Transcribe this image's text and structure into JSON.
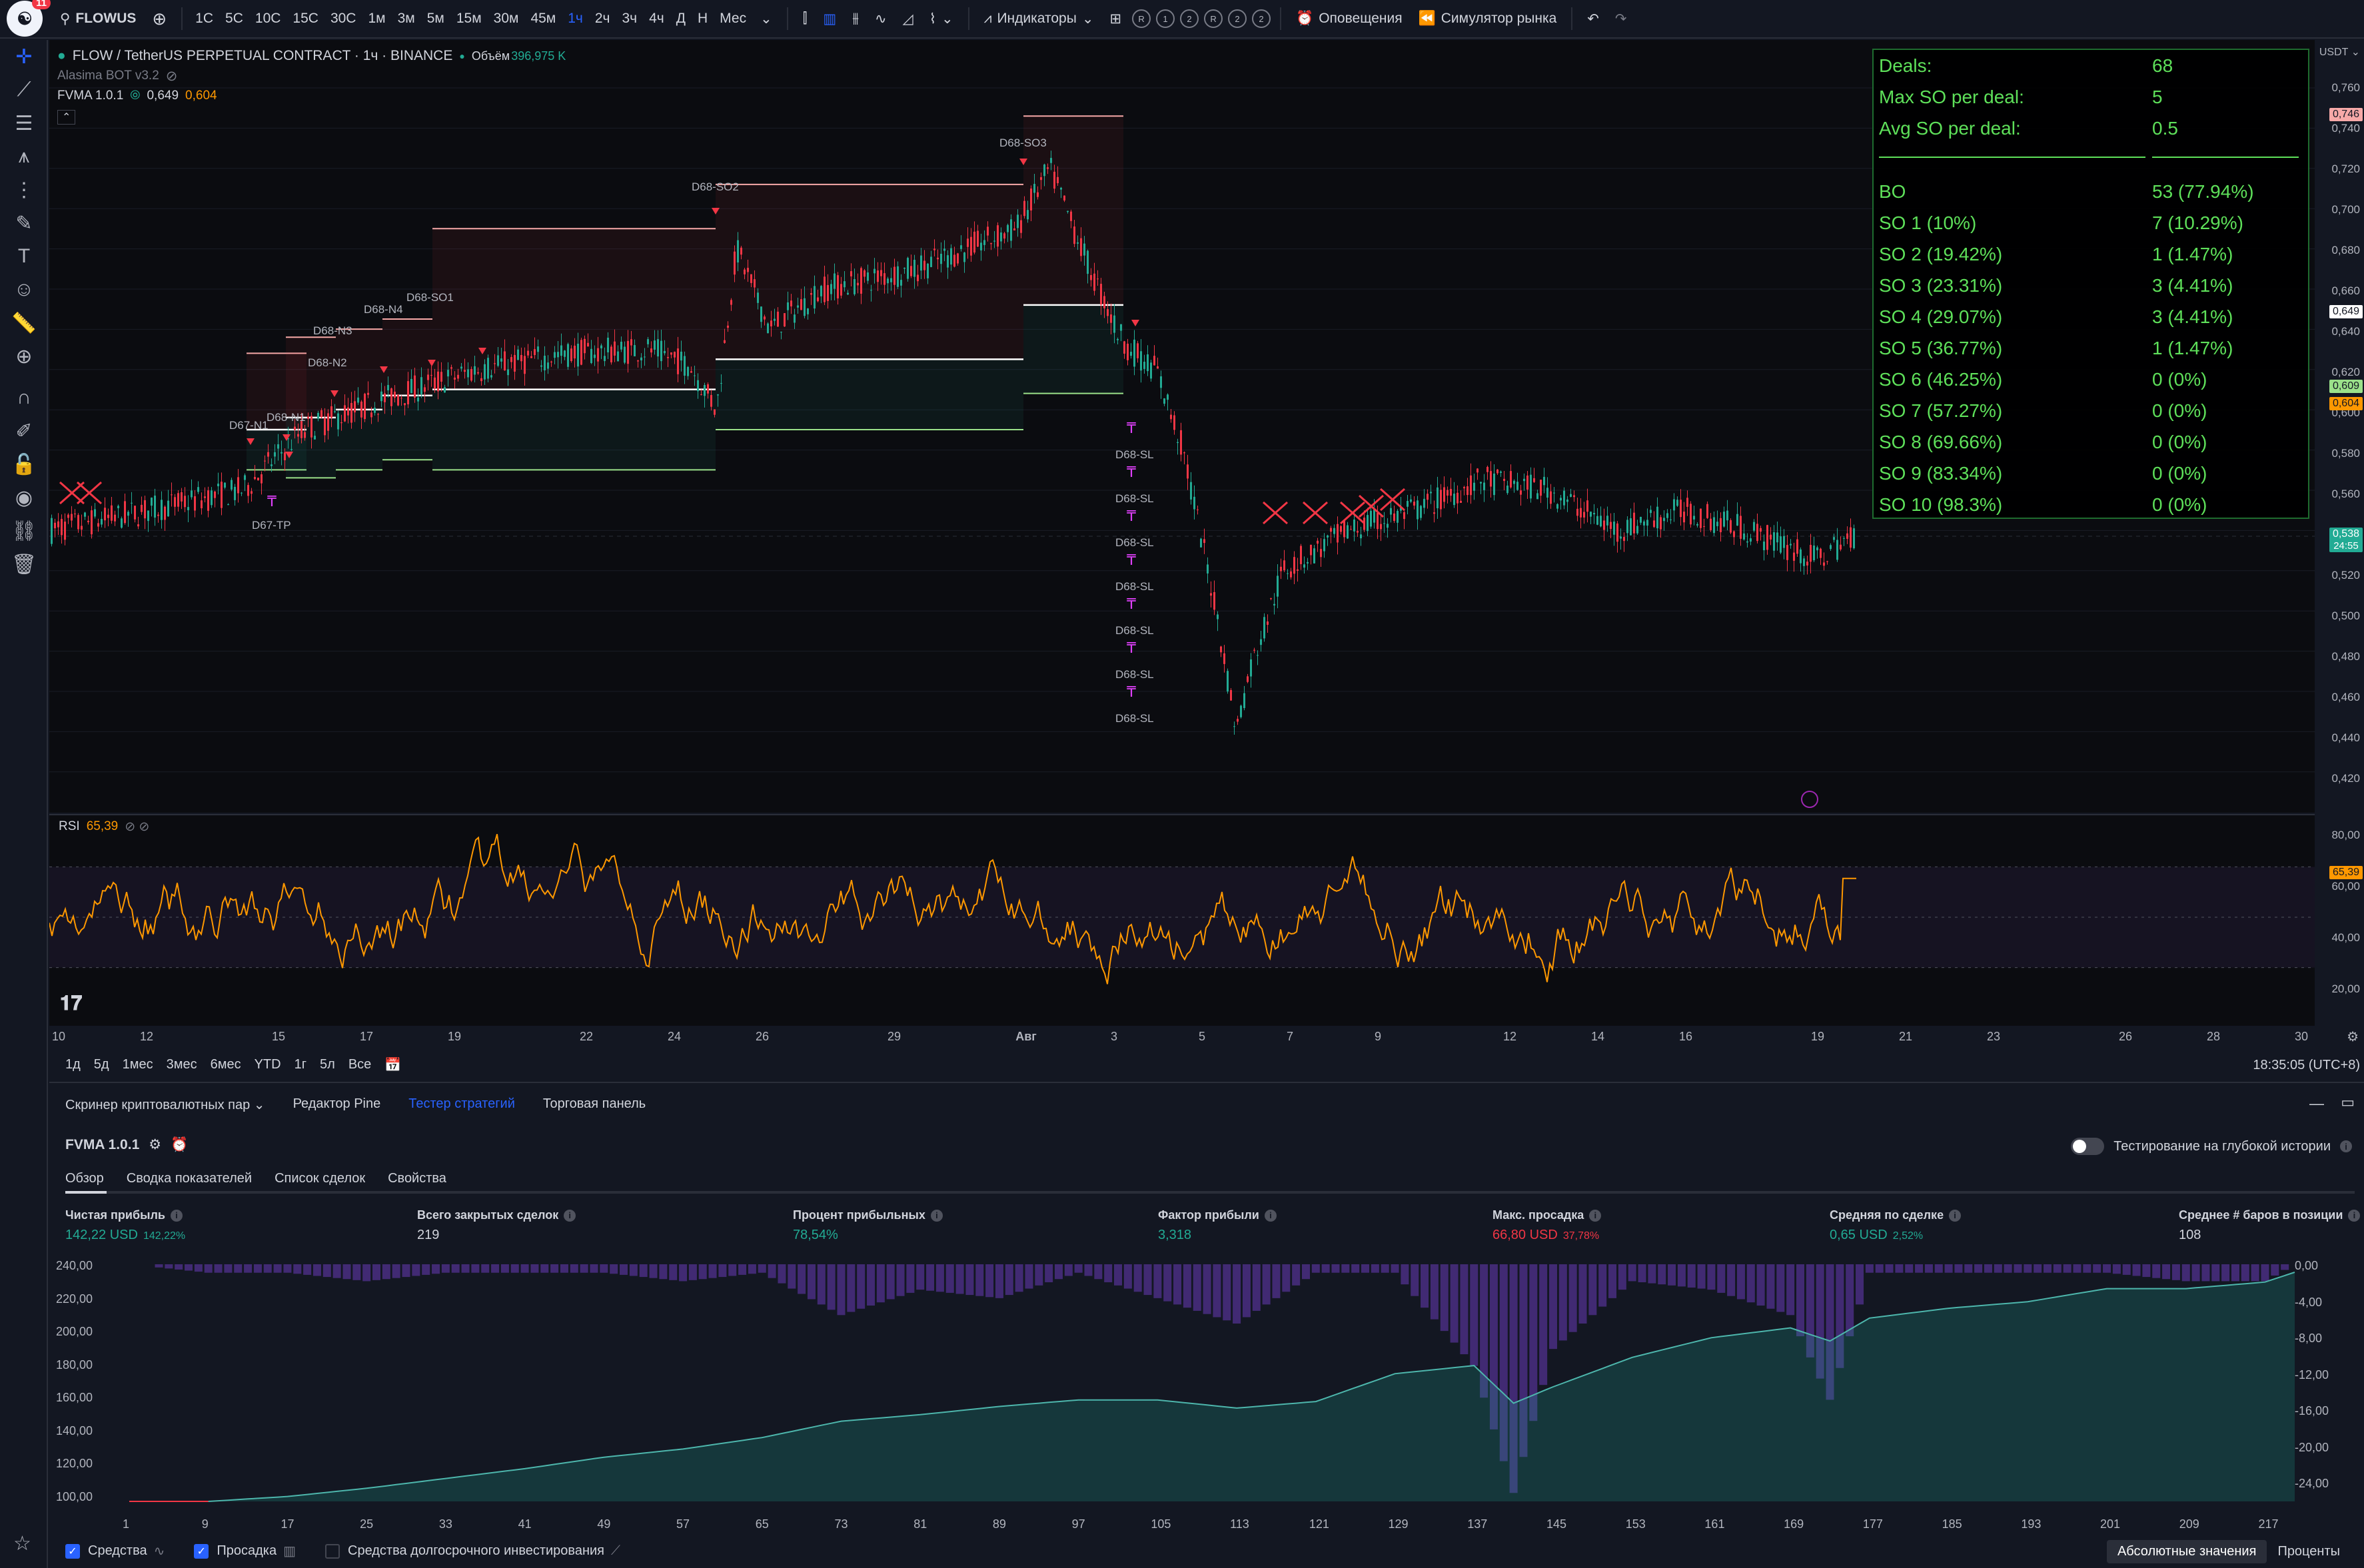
{
  "topbar": {
    "badge": "11",
    "symbol": "FLOWUS",
    "intervals": [
      "1С",
      "5С",
      "10С",
      "15С",
      "30С",
      "1м",
      "3м",
      "5м",
      "15м",
      "30м",
      "45м",
      "1ч",
      "2ч",
      "3ч",
      "4ч",
      "Д",
      "Н",
      "Мес"
    ],
    "active_interval": "1ч",
    "indicators_label": "Индикаторы",
    "circle_buttons": [
      "R",
      "1",
      "2",
      "R",
      "2",
      "2"
    ],
    "alerts_label": "Оповещения",
    "replay_label": "Симулятор рынка"
  },
  "legend": {
    "title": "FLOW / TetherUS PERPETUAL CONTRACT · 1ч · BINANCE",
    "volume_label": "Объём",
    "volume_value": "396,975 K",
    "bot_label": "Alasima BOT v3.2",
    "fvma_label": "FVMA 1.0.1",
    "fvma_v1": "0,649",
    "fvma_v2": "0,604"
  },
  "stats": [
    {
      "k": "Deals:",
      "v": "68"
    },
    {
      "k": "Max SO per deal:",
      "v": "5"
    },
    {
      "k": "Avg SO per deal:",
      "v": "0.5"
    },
    {
      "k": "BO",
      "v": "53 (77.94%)"
    },
    {
      "k": "SO 1 (10%)",
      "v": "7 (10.29%)"
    },
    {
      "k": "SO 2 (19.42%)",
      "v": "1 (1.47%)"
    },
    {
      "k": "SO 3 (23.31%)",
      "v": "3 (4.41%)"
    },
    {
      "k": "SO 4 (29.07%)",
      "v": "3 (4.41%)"
    },
    {
      "k": "SO 5 (36.77%)",
      "v": "1 (1.47%)"
    },
    {
      "k": "SO 6 (46.25%)",
      "v": "0 (0%)"
    },
    {
      "k": "SO 7 (57.27%)",
      "v": "0 (0%)"
    },
    {
      "k": "SO 8 (69.66%)",
      "v": "0 (0%)"
    },
    {
      "k": "SO 9 (83.34%)",
      "v": "0 (0%)"
    },
    {
      "k": "SO 10 (98.3%)",
      "v": "0 (0%)"
    }
  ],
  "price_axis": {
    "currency": "USDT",
    "ticks": [
      "0,760",
      "0,740",
      "0,720",
      "0,700",
      "0,680",
      "0,660",
      "0,640",
      "0,620",
      "0,600",
      "0,580",
      "0,560",
      "0,540",
      "0,520",
      "0,500",
      "0,480",
      "0,460",
      "0,440",
      "0,420"
    ],
    "tag_high": "0,746",
    "tag_fvma": "0,649",
    "tag_green": "0,609",
    "tag_orange": "0,604",
    "tag_last": "0,538",
    "tag_countdown": "24:55"
  },
  "chart_labels": {
    "d67_n1": "D67-N1",
    "d67_tp": "D67-TP",
    "d68_n1": "D68-N1",
    "d68_n2": "D68-N2",
    "d68_n3": "D68-N3",
    "d68_n4": "D68-N4",
    "d68_so1": "D68-SO1",
    "d68_so2": "D68-SO2",
    "d68_so3": "D68-SO3",
    "d68_sl": "D68-SL"
  },
  "rsi": {
    "label": "RSI",
    "value": "65,39",
    "ticks": [
      "80,00",
      "60,00",
      "40,00",
      "20,00"
    ]
  },
  "time_axis": [
    "10",
    "12",
    "15",
    "17",
    "19",
    "22",
    "24",
    "26",
    "29",
    "Авг",
    "3",
    "5",
    "7",
    "9",
    "12",
    "14",
    "16",
    "19",
    "21",
    "23",
    "26",
    "28",
    "30"
  ],
  "range_bar": {
    "items": [
      "1д",
      "5д",
      "1мес",
      "3мес",
      "6мес",
      "YTD",
      "1г",
      "5л",
      "Все"
    ],
    "clock": "18:35:05 (UTC+8)"
  },
  "bottom": {
    "tabs": [
      "Скринер криптовалютных пар",
      "Редактор Pine",
      "Тестер стратегий",
      "Торговая панель"
    ],
    "active_tab": "Тестер стратегий",
    "strategy": "FVMA 1.0.1",
    "deep_history": "Тестирование на глубокой истории",
    "sub_tabs": [
      "Обзор",
      "Сводка показателей",
      "Список сделок",
      "Свойства"
    ],
    "metrics": [
      {
        "k": "Чистая прибыль",
        "v": "142,22 USD",
        "p": "142,22%",
        "c": "green"
      },
      {
        "k": "Всего закрытых сделок",
        "v": "219",
        "p": "",
        "c": "white"
      },
      {
        "k": "Процент прибыльных",
        "v": "78,54%",
        "p": "",
        "c": "green"
      },
      {
        "k": "Фактор прибыли",
        "v": "3,318",
        "p": "",
        "c": "green"
      },
      {
        "k": "Макс. просадка",
        "v": "66,80 USD",
        "p": "37,78%",
        "c": "red"
      },
      {
        "k": "Средняя по сделке",
        "v": "0,65 USD",
        "p": "2,52%",
        "c": "green"
      },
      {
        "k": "Среднее # баров в позиции",
        "v": "108",
        "p": "",
        "c": "white"
      }
    ],
    "legend": [
      "Средства",
      "Просадка",
      "Средства долгосрочного инвестирования"
    ],
    "view_modes": [
      "Абсолютные значения",
      "Проценты"
    ]
  },
  "chart_data": [
    {
      "type": "line",
      "name_on_chart": "RSI",
      "y_ticks": [
        80,
        60,
        40,
        20
      ],
      "last_value": 65.39
    },
    {
      "type": "area",
      "x_ticks": [
        1,
        9,
        17,
        25,
        33,
        41,
        49,
        57,
        65,
        73,
        81,
        89,
        97,
        105,
        113,
        121,
        129,
        137,
        145,
        153,
        161,
        169,
        177,
        185,
        193,
        201,
        209,
        217
      ],
      "left_axis_ticks": [
        "240,00",
        "220,00",
        "200,00",
        "180,00",
        "160,00",
        "140,00",
        "120,00",
        "100,00"
      ],
      "right_axis_ticks": [
        "0,00",
        "-4,00",
        "-8,00",
        "-12,00",
        "-16,00",
        "-20,00",
        "-24,00"
      ],
      "ylim_left": [
        100,
        240
      ],
      "ylim_right": [
        -28,
        0
      ],
      "equity_series": {
        "x": [
          1,
          9,
          17,
          25,
          33,
          41,
          49,
          57,
          65,
          73,
          81,
          89,
          97,
          105,
          113,
          121,
          129,
          137,
          141,
          145,
          153,
          161,
          169,
          173,
          177,
          185,
          193,
          201,
          209,
          217,
          220
        ],
        "values": [
          100,
          100,
          103,
          108,
          114,
          120,
          127,
          132,
          139,
          149,
          153,
          158,
          162,
          162,
          157,
          161,
          178,
          183,
          160,
          170,
          188,
          200,
          206,
          198,
          212,
          218,
          222,
          230,
          230,
          234,
          240
        ]
      },
      "drawdown_series": {
        "x": [
          1,
          9,
          17,
          25,
          33,
          41,
          49,
          57,
          65,
          73,
          81,
          89,
          97,
          105,
          113,
          121,
          129,
          137,
          141,
          145,
          153,
          161,
          169,
          173,
          177,
          185,
          193,
          201,
          209,
          217,
          220
        ],
        "values": [
          0,
          -1,
          -1,
          -2,
          -1,
          -1,
          -1,
          -2,
          -1,
          -6,
          -3,
          -4,
          -1,
          -4,
          -7,
          -1,
          -1,
          -12,
          -27,
          -10,
          -2,
          -3,
          -6,
          -16,
          -1,
          -1,
          -1,
          -1,
          -2,
          -2,
          0
        ]
      }
    }
  ]
}
